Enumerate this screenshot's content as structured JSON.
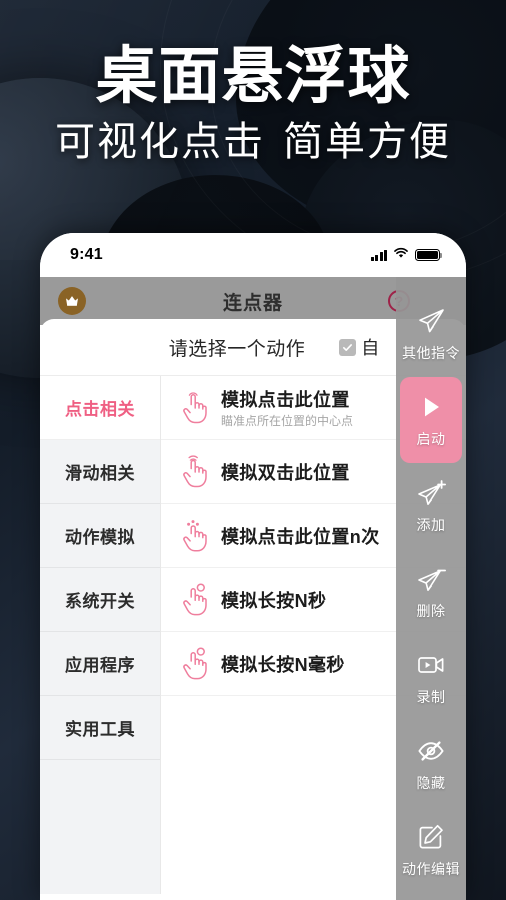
{
  "poster": {
    "title_main": "桌面悬浮球",
    "title_sub_left": "可视化点击",
    "title_sub_right": "简单方便",
    "bg_color": "#141d29",
    "accent_pink": "#ef5f83"
  },
  "phone": {
    "statusbar": {
      "time": "9:41",
      "signal_icon": "signal-bars-icon",
      "wifi_icon": "wifi-icon",
      "battery_icon": "battery-icon"
    },
    "titlebar": {
      "app_title": "连点器",
      "crown_icon": "crown-icon",
      "help_icon": "question-circle-icon",
      "bg_color": "#9a9a9a"
    },
    "topbar": {
      "prompt": "请选择一个动作",
      "auto_label": "自",
      "checkbox_checked": true
    },
    "categories": [
      {
        "label": "点击相关",
        "active": true
      },
      {
        "label": "滑动相关",
        "active": false
      },
      {
        "label": "动作模拟",
        "active": false
      },
      {
        "label": "系统开关",
        "active": false
      },
      {
        "label": "应用程序",
        "active": false
      },
      {
        "label": "实用工具",
        "active": false
      }
    ],
    "actions": [
      {
        "title": "模拟点击此位置",
        "subtitle": "瞄准点所在位置的中心点",
        "icon": "tap-hand-icon"
      },
      {
        "title": "模拟双击此位置",
        "subtitle": "",
        "icon": "double-tap-hand-icon"
      },
      {
        "title": "模拟点击此位置n次",
        "subtitle": "",
        "icon": "multi-tap-hand-icon"
      },
      {
        "title": "模拟长按N秒",
        "subtitle": "",
        "icon": "long-press-hand-icon"
      },
      {
        "title": "模拟长按N毫秒",
        "subtitle": "",
        "icon": "long-press-hand-icon"
      }
    ],
    "float_panel": {
      "bg_color": "#969696",
      "primary_color": "#ef8fa8",
      "items": [
        {
          "label": "其他指令",
          "icon": "paper-plane-icon",
          "primary": false
        },
        {
          "label": "启动",
          "icon": "play-icon",
          "primary": true
        },
        {
          "label": "添加",
          "icon": "paper-plane-plus-icon",
          "primary": false
        },
        {
          "label": "删除",
          "icon": "paper-plane-minus-icon",
          "primary": false
        },
        {
          "label": "录制",
          "icon": "video-record-icon",
          "primary": false
        },
        {
          "label": "隐藏",
          "icon": "eye-slash-icon",
          "primary": false
        },
        {
          "label": "动作编辑",
          "icon": "edit-pencil-icon",
          "primary": false
        }
      ]
    }
  }
}
